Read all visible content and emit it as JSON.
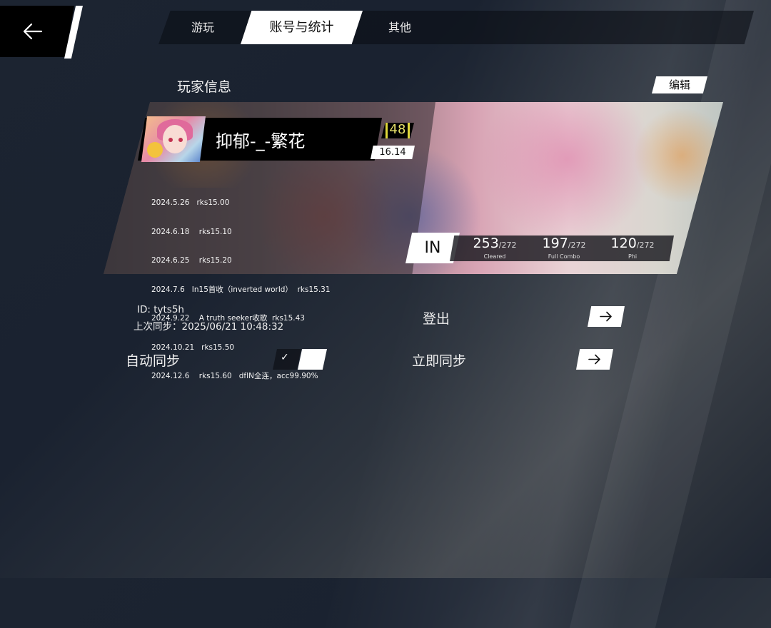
{
  "tabs": [
    {
      "label": "游玩",
      "active": false
    },
    {
      "label": "账号与统计",
      "active": true
    },
    {
      "label": "其他",
      "active": false
    }
  ],
  "section_title": "玩家信息",
  "edit_label": "编辑",
  "player": {
    "name": "抑郁-_-繁花",
    "level": "48",
    "rks": "16.14",
    "history": [
      "2024.5.26   rks15.00",
      "2024.6.18    rks15.10",
      "2024.6.25    rks15.20",
      "2024.7.6   In15首收（inverted world）  rks15.31",
      "2024.9.22    A truth seeker收歌  rks15.43",
      "2024.10.21   rks15.50",
      "2024.12.6    rks15.60   dfIN全连，acc99.90%"
    ],
    "difficulty": "IN",
    "stats": [
      {
        "value": "253",
        "total": "/272",
        "label": "Cleared"
      },
      {
        "value": "197",
        "total": "/272",
        "label": "Full Combo"
      },
      {
        "value": "120",
        "total": "/272",
        "label": "Phi"
      }
    ]
  },
  "account": {
    "id_text": "ID: tyts5h",
    "last_sync_text": "上次同步：2025/06/21 10:48:32",
    "logout_label": "登出",
    "auto_sync_label": "自动同步",
    "auto_sync_checked": true,
    "sync_now_label": "立即同步",
    "check_mark": "✓"
  },
  "icons": {
    "back": "back-arrow-icon",
    "arrow": "arrow-right-icon",
    "check": "check-icon"
  },
  "colors": {
    "level_accent": "#e0d83a",
    "background": "#1c2431"
  }
}
